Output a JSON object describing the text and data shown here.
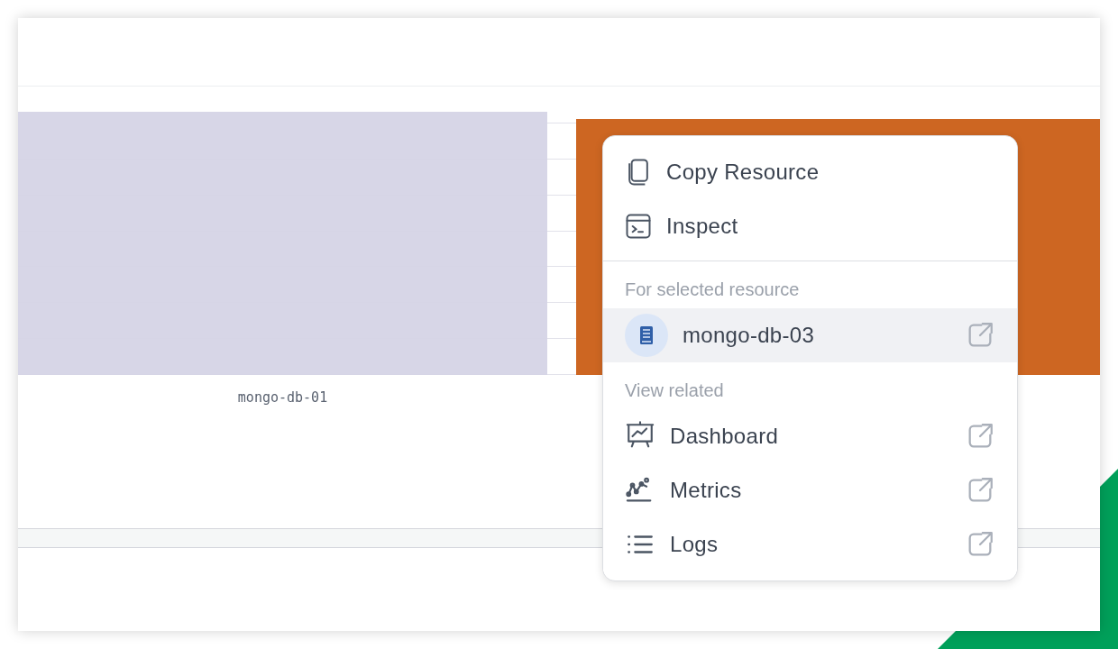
{
  "chart": {
    "x_label": "mongo-db-01"
  },
  "menu": {
    "actions": [
      {
        "label": "Copy Resource"
      },
      {
        "label": "Inspect"
      }
    ],
    "selected_section": {
      "heading": "For selected resource",
      "items": [
        {
          "label": "mongo-db-03",
          "selected": true
        }
      ]
    },
    "related_section": {
      "heading": "View related",
      "items": [
        {
          "label": "Dashboard",
          "selected": false
        },
        {
          "label": "Metrics",
          "selected": false
        },
        {
          "label": "Logs",
          "selected": false
        }
      ]
    }
  }
}
